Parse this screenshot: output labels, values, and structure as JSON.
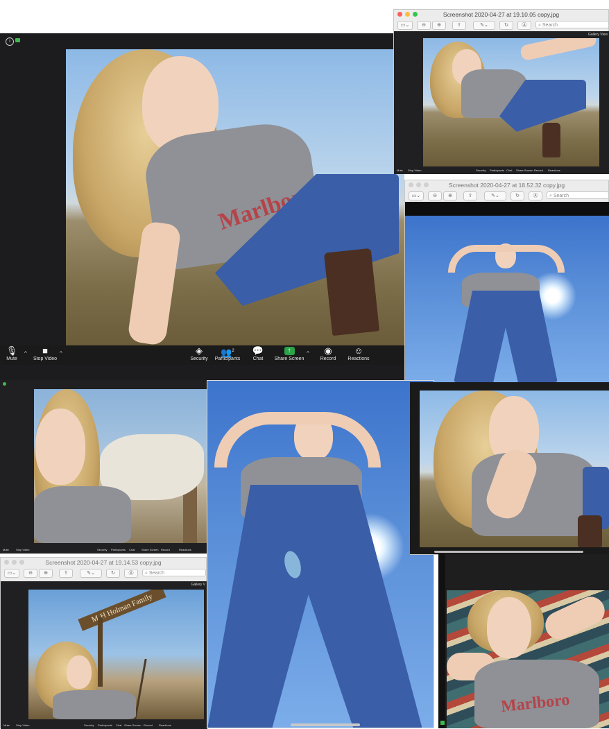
{
  "main_zoom": {
    "toolbar": {
      "mute": "Mute",
      "stop_video": "Stop Video",
      "security": "Security",
      "participants": "Participants",
      "participants_count": "2",
      "chat": "Chat",
      "share_screen": "Share Screen",
      "record": "Record",
      "reactions": "Reactions"
    },
    "shirt_text": "Marlboro"
  },
  "preview_windows": [
    {
      "title": "Screenshot 2020-04-27 at 19.10.05 copy.jpg",
      "search_placeholder": "Search",
      "gallery_label": "Gallery View"
    },
    {
      "title": "Screenshot 2020-04-27 at 18.52.32 copy.jpg",
      "search_placeholder": "Search"
    },
    {
      "title": "Screenshot 2020-04-27 at 19.14.53 copy.jpg",
      "search_placeholder": "Search",
      "gallery_label": "Gallery V"
    }
  ],
  "small_toolbar": {
    "mute": "Mute",
    "stop_video": "Stop Video",
    "security": "Security",
    "participants": "Participants",
    "chat": "Chat",
    "share_screen": "Share Screen",
    "record": "Record",
    "reactions": "Reactions"
  },
  "sign_text": "M-H Holman Family",
  "bottom_right_shirt": "Marlboro",
  "colors": {
    "zoom_share_green": "#2aa34a",
    "zoom_bar": "#1a1a1a",
    "mac_close": "#fc605c",
    "mac_min": "#fdbc40",
    "mac_max": "#34c84a"
  }
}
